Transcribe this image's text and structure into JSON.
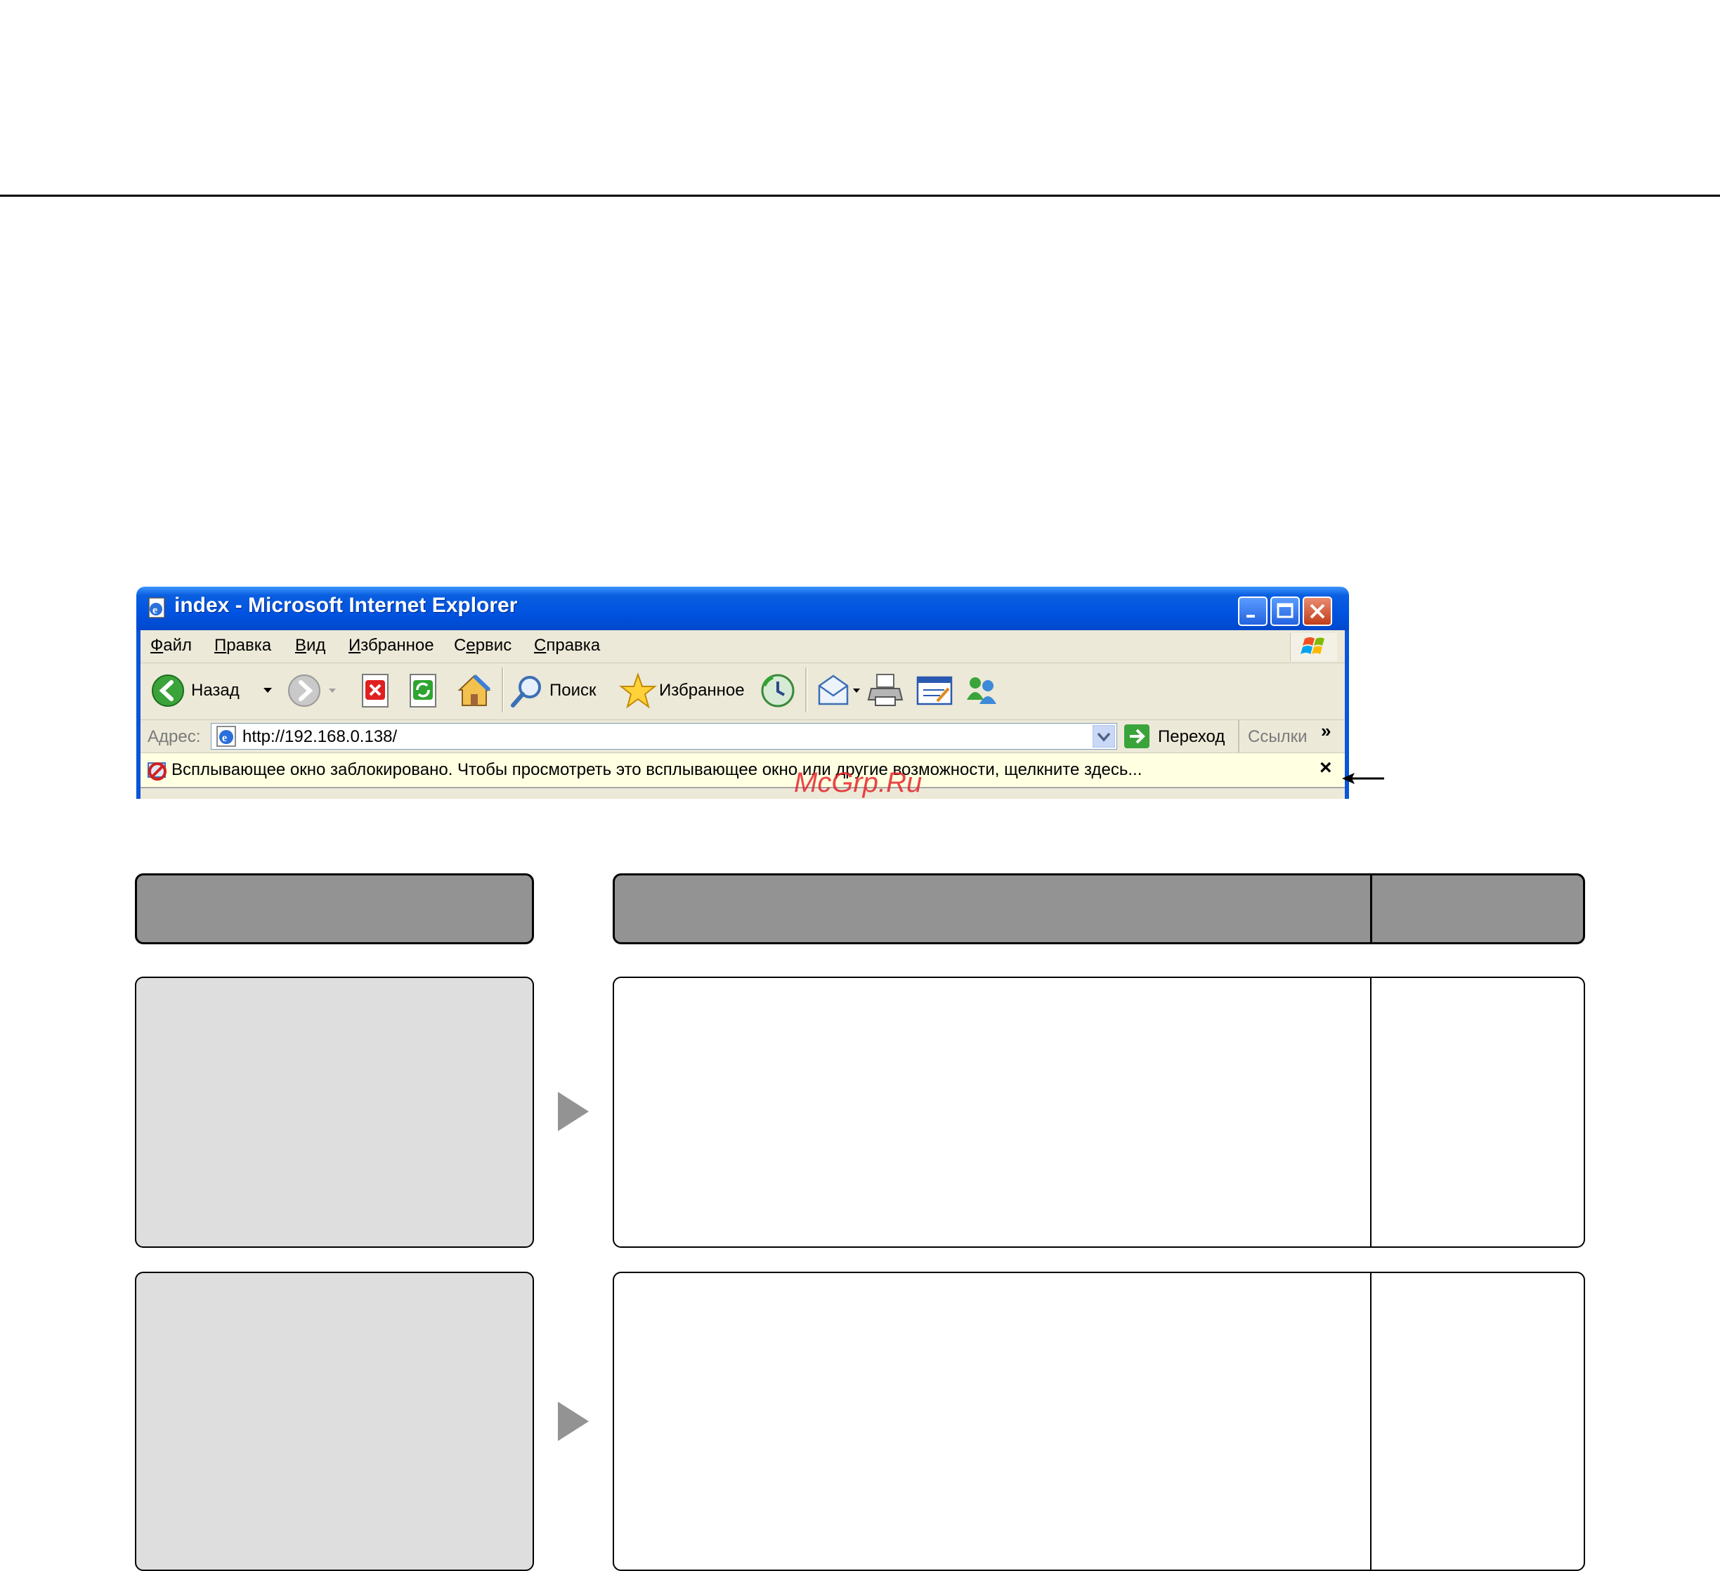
{
  "window": {
    "title": "index - Microsoft Internet Explorer"
  },
  "menu": {
    "items": [
      {
        "u": "Ф",
        "rest": "айл"
      },
      {
        "u": "П",
        "rest": "равка"
      },
      {
        "u": "В",
        "rest": "ид"
      },
      {
        "u": "И",
        "rest": "збранное"
      },
      {
        "pre": "С",
        "u": "е",
        "rest": "рвис"
      },
      {
        "u": "С",
        "rest": "правка"
      }
    ]
  },
  "toolbar": {
    "back_label": "Назад",
    "search_label": "Поиск",
    "favorites_label": "Избранное"
  },
  "address": {
    "label": "Адрес:",
    "url": "http://192.168.0.138/",
    "go_label": "Переход",
    "links_label": "Ссылки",
    "more": "»"
  },
  "infobar": {
    "message": "Всплывающее окно заблокировано. Чтобы просмотреть это всплывающее окно или другие возможности, щелкните здесь...",
    "close": "×"
  },
  "watermark": "McGrp.Ru",
  "colors": {
    "titlebar": "#0053e1",
    "chrome": "#ece9d8",
    "infobar": "#ffffe1",
    "header_box": "#939393",
    "grey_cell": "#dedede",
    "arrow": "#939393"
  }
}
